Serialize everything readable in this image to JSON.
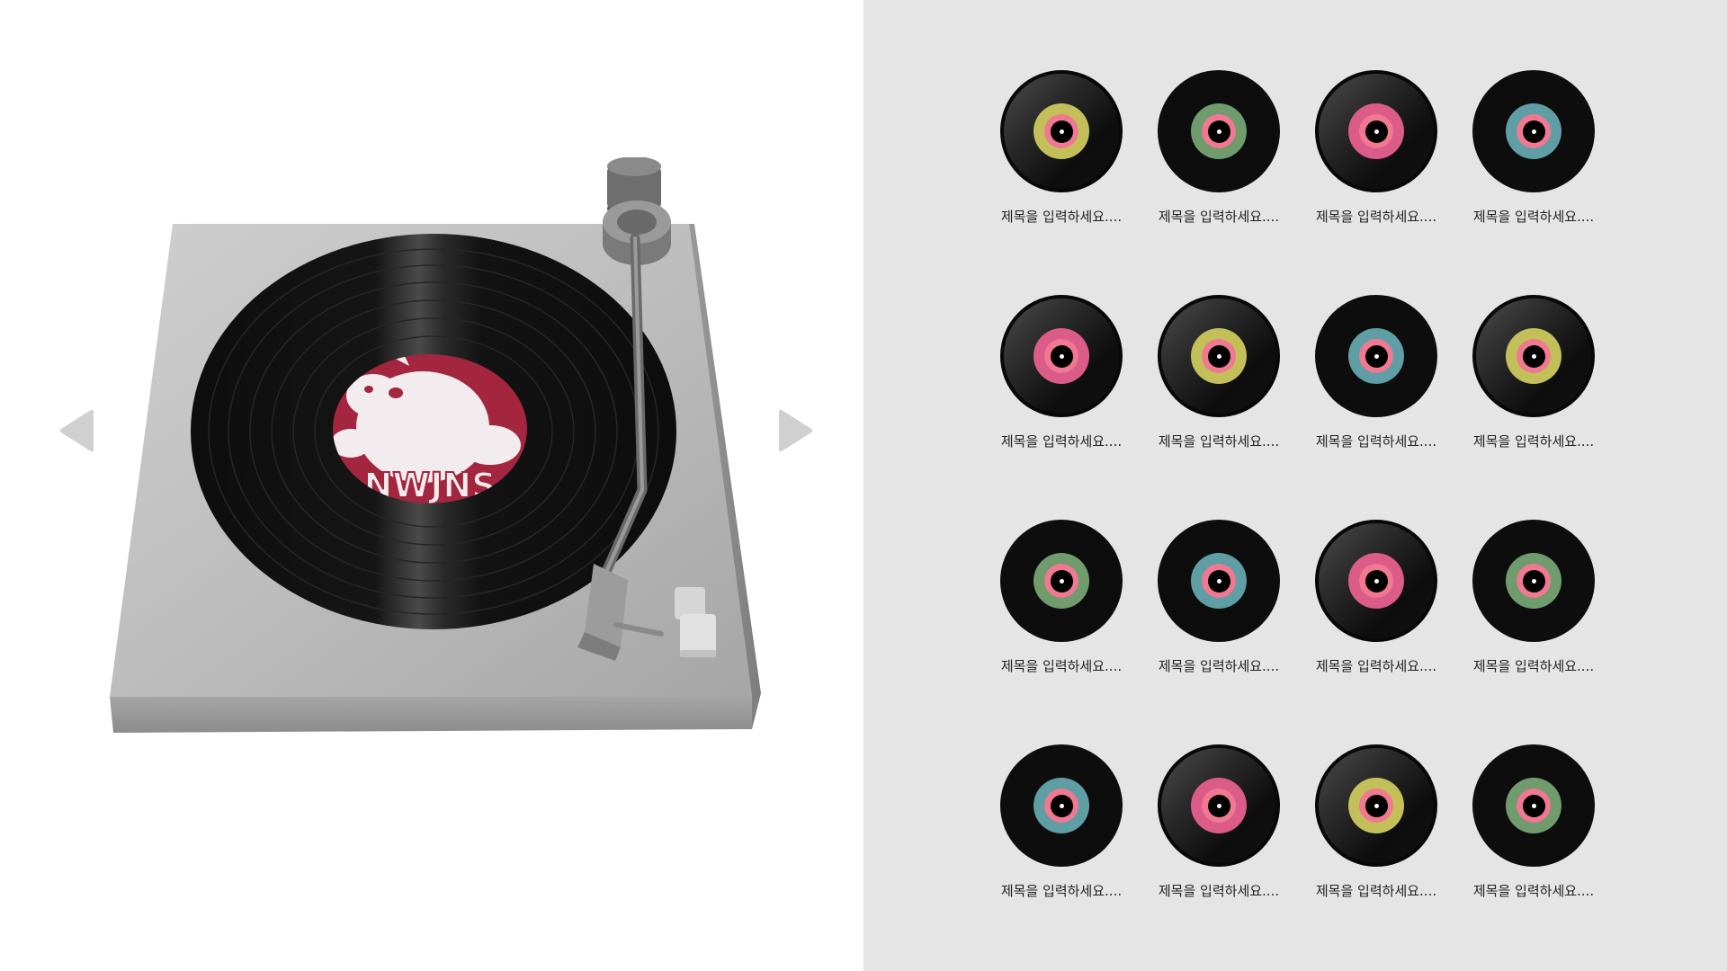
{
  "colors": {
    "left_bg": "#ffffff",
    "right_bg": "#e5e5e5",
    "arrow": "#d0d0d0",
    "vinyl": "#0d0d0d",
    "label_red": "#a3263e",
    "label_yellow": "#c3c05a",
    "label_green": "#6f9b6d",
    "label_teal": "#5f9ea5",
    "label_pink": "#db5c88",
    "label_center": "#f07890"
  },
  "turntable": {
    "album_art_text": "NWJNS",
    "prev_icon": "triangle-left-icon",
    "next_icon": "triangle-right-icon"
  },
  "records": [
    {
      "title": "제목을 입력하세요....",
      "ring": "#c3c05a",
      "style": "gloss"
    },
    {
      "title": "제목을 입력하세요....",
      "ring": "#6f9b6d",
      "style": "dark"
    },
    {
      "title": "제목을 입력하세요....",
      "ring": "#db5c88",
      "style": "gloss"
    },
    {
      "title": "제목을 입력하세요....",
      "ring": "#5f9ea5",
      "style": "dark"
    },
    {
      "title": "제목을 입력하세요....",
      "ring": "#db5c88",
      "style": "gloss"
    },
    {
      "title": "제목을 입력하세요....",
      "ring": "#c3c05a",
      "style": "gloss"
    },
    {
      "title": "제목을 입력하세요....",
      "ring": "#5f9ea5",
      "style": "dark"
    },
    {
      "title": "제목을 입력하세요....",
      "ring": "#c3c05a",
      "style": "gloss"
    },
    {
      "title": "제목을 입력하세요....",
      "ring": "#6f9b6d",
      "style": "dark"
    },
    {
      "title": "제목을 입력하세요....",
      "ring": "#5f9ea5",
      "style": "dark"
    },
    {
      "title": "제목을 입력하세요....",
      "ring": "#db5c88",
      "style": "gloss"
    },
    {
      "title": "제목을 입력하세요....",
      "ring": "#6f9b6d",
      "style": "dark"
    },
    {
      "title": "제목을 입력하세요....",
      "ring": "#5f9ea5",
      "style": "dark"
    },
    {
      "title": "제목을 입력하세요....",
      "ring": "#db5c88",
      "style": "gloss"
    },
    {
      "title": "제목을 입력하세요....",
      "ring": "#c3c05a",
      "style": "gloss"
    },
    {
      "title": "제목을 입력하세요....",
      "ring": "#6f9b6d",
      "style": "dark"
    }
  ]
}
